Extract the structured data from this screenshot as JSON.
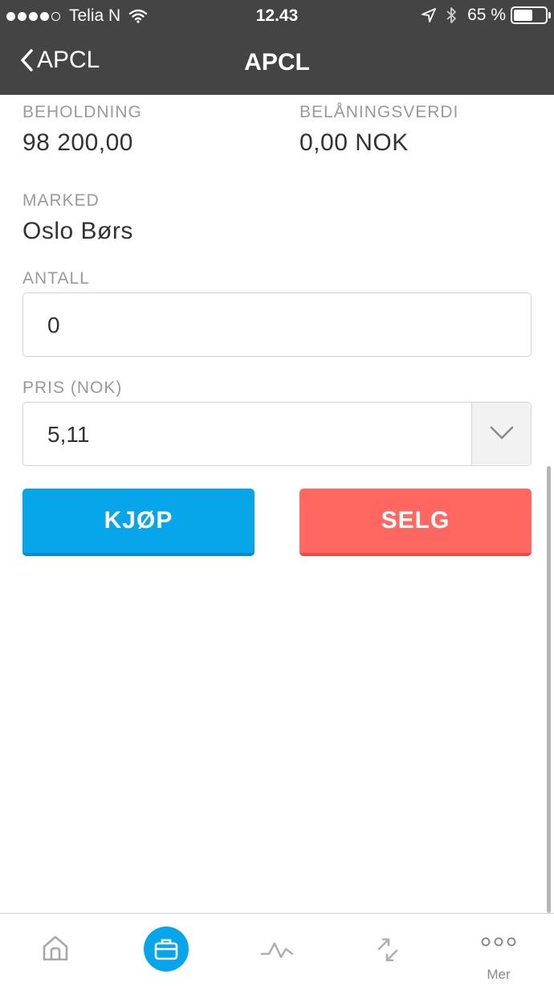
{
  "status_bar": {
    "carrier": "Telia N",
    "time": "12.43",
    "battery_pct": "65 %",
    "battery_level": 0.65
  },
  "nav": {
    "back_label": "APCL",
    "title": "APCL"
  },
  "holdings": {
    "beholdning_label": "BEHOLDNING",
    "beholdning_value": "98 200,00",
    "belaning_label": "BELÅNINGSVERDI",
    "belaning_value": "0,00 NOK"
  },
  "market": {
    "label": "MARKED",
    "value": "Oslo Børs"
  },
  "quantity": {
    "label": "ANTALL",
    "value": "0"
  },
  "price": {
    "label": "PRIS (NOK)",
    "value": "5,11"
  },
  "actions": {
    "buy_label": "KJØP",
    "sell_label": "SELG"
  },
  "tabbar": {
    "items": [
      {
        "icon": "home-icon"
      },
      {
        "icon": "briefcase-icon",
        "active": true
      },
      {
        "icon": "chart-line-icon"
      },
      {
        "icon": "transfer-icon"
      },
      {
        "icon": "more-icon",
        "label": "Mer"
      }
    ]
  },
  "colors": {
    "topbar": "#444444",
    "buy": "#07a6ea",
    "sell": "#ff6760",
    "label": "#9a9a9a"
  }
}
